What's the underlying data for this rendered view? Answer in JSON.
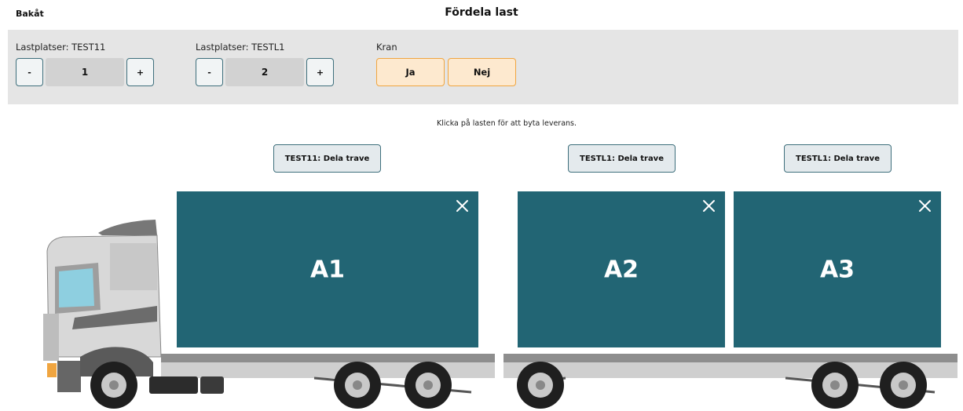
{
  "header": {
    "back_label": "Bakåt",
    "title": "Fördela last"
  },
  "controls": {
    "stepper1": {
      "label": "Lastplatser: TEST11",
      "minus": "-",
      "value": "1",
      "plus": "+"
    },
    "stepper2": {
      "label": "Lastplatser: TESTL1",
      "minus": "-",
      "value": "2",
      "plus": "+"
    },
    "kran": {
      "label": "Kran",
      "yes": "Ja",
      "no": "Nej"
    }
  },
  "hint": "Klicka på lasten för att byta leverans.",
  "split_buttons": [
    "TEST11: Dela trave",
    "TESTL1: Dela trave",
    "TESTL1: Dela trave"
  ],
  "loads": [
    {
      "label": "A1",
      "close_icon": "close-icon"
    },
    {
      "label": "A2",
      "close_icon": "close-icon"
    },
    {
      "label": "A3",
      "close_icon": "close-icon"
    }
  ],
  "colors": {
    "load": "#226574",
    "accent_border": "#3e6f7c",
    "kran_border": "#f0a540",
    "kran_bg": "#fde9cf",
    "panel": "#e5e5e5"
  }
}
